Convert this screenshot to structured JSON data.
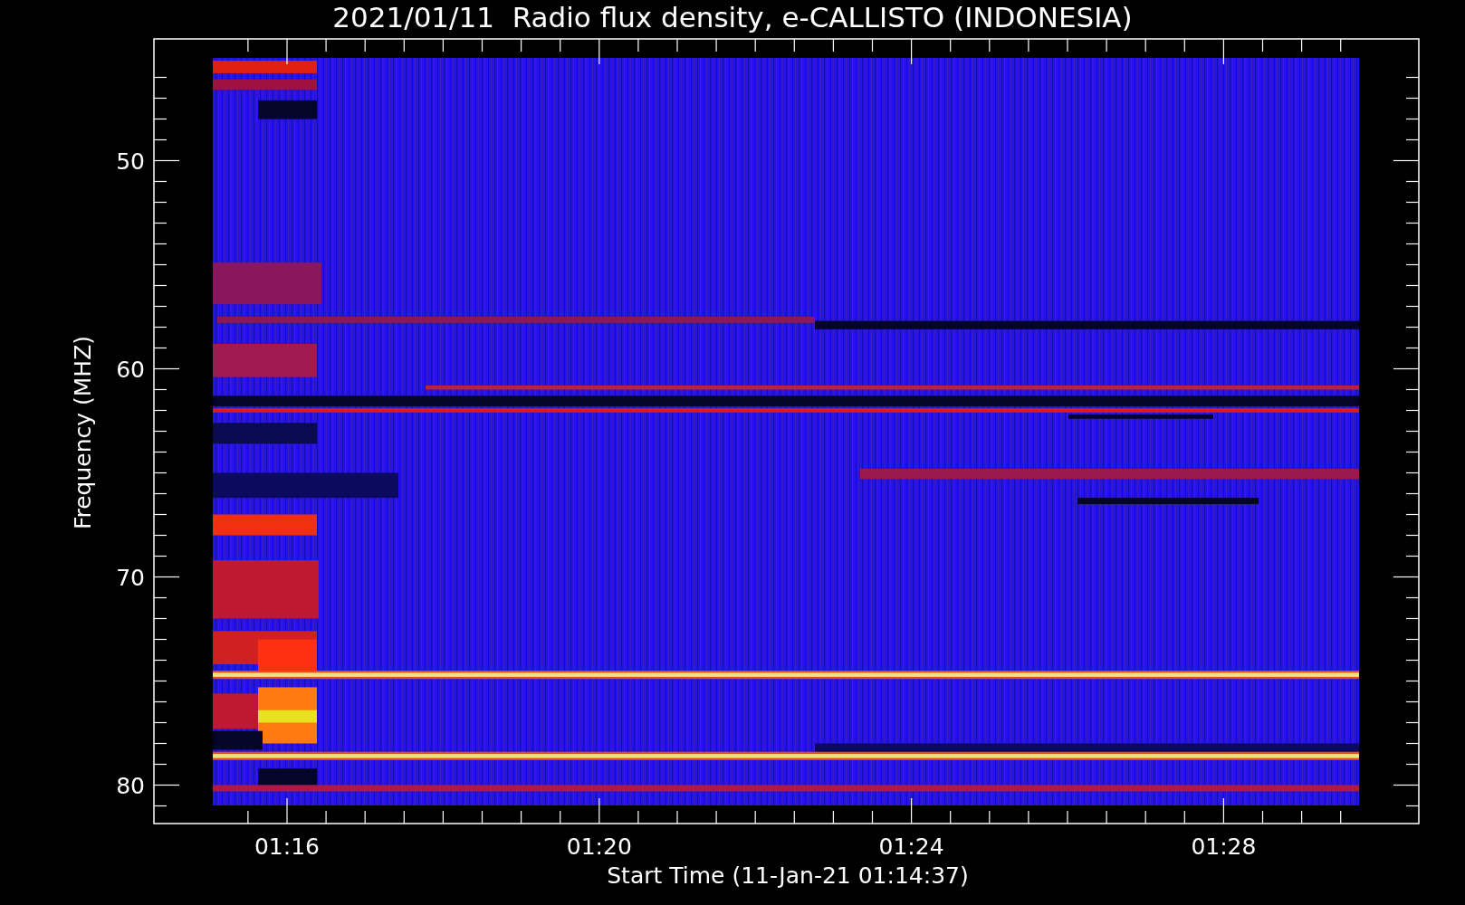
{
  "title": "2021/01/11  Radio flux density, e-CALLISTO (INDONESIA)",
  "y_axis": {
    "label": "Frequency (MHZ)",
    "tick_labels": [
      "50",
      "60",
      "70",
      "80"
    ]
  },
  "x_axis": {
    "label": "Start Time (11-Jan-21 01:14:37)",
    "tick_labels": [
      "01:16",
      "01:20",
      "01:24",
      "01:28"
    ]
  }
}
